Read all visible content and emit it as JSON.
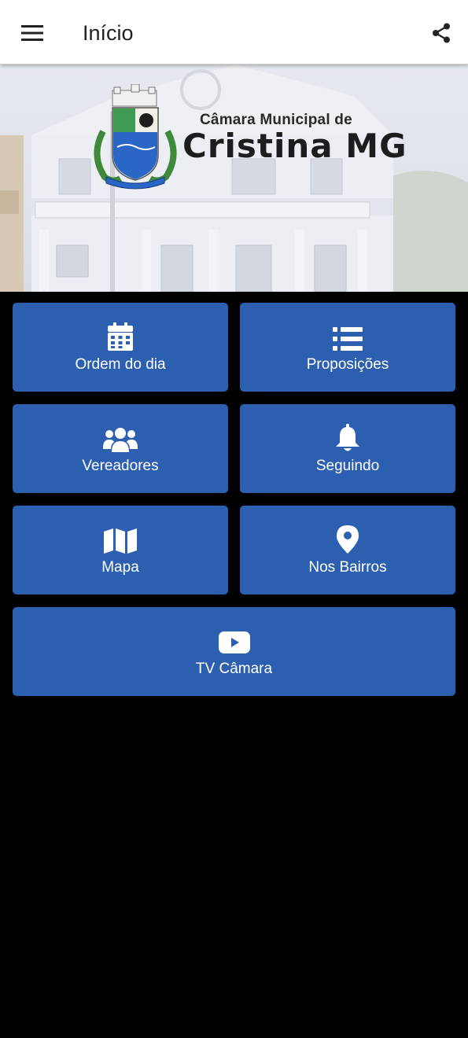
{
  "appbar": {
    "title": "Início",
    "menu_icon": "hamburger-menu-icon",
    "share_icon": "share-icon"
  },
  "banner": {
    "line1": "Câmara Municipal de",
    "line2": "Cristina MG"
  },
  "tiles": [
    {
      "label": "Ordem do dia",
      "icon": "calendar-icon"
    },
    {
      "label": "Proposições",
      "icon": "list-icon"
    },
    {
      "label": "Vereadores",
      "icon": "users-icon"
    },
    {
      "label": "Seguindo",
      "icon": "bell-icon"
    },
    {
      "label": "Mapa",
      "icon": "map-icon"
    },
    {
      "label": "Nos Bairros",
      "icon": "map-pin-icon"
    },
    {
      "label": "TV Câmara",
      "icon": "youtube-icon"
    }
  ],
  "colors": {
    "tile_background": "#2c5fb0",
    "page_background": "#000000",
    "appbar_background": "#ffffff"
  }
}
